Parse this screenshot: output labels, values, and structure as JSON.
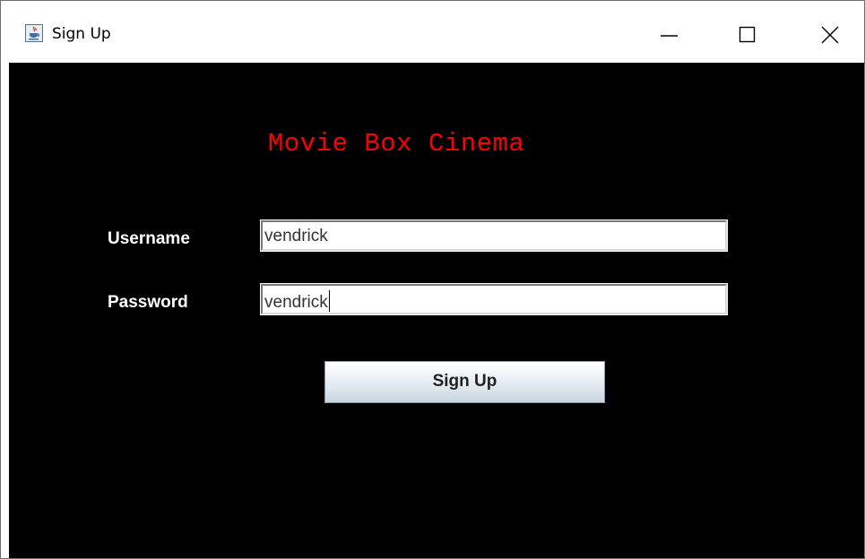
{
  "window": {
    "title": "Sign Up",
    "app_icon": "java-coffee-cup-icon",
    "controls": {
      "minimize_icon": "minimize-icon",
      "maximize_icon": "maximize-icon",
      "close_icon": "close-icon"
    }
  },
  "form": {
    "heading": "Movie Box Cinema",
    "username_label": "Username",
    "username_value": "vendrick",
    "password_label": "Password",
    "password_value": "vendrick",
    "submit_label": "Sign Up"
  },
  "colors": {
    "background": "#000000",
    "heading": "#ff0000",
    "label": "#ffffff"
  }
}
